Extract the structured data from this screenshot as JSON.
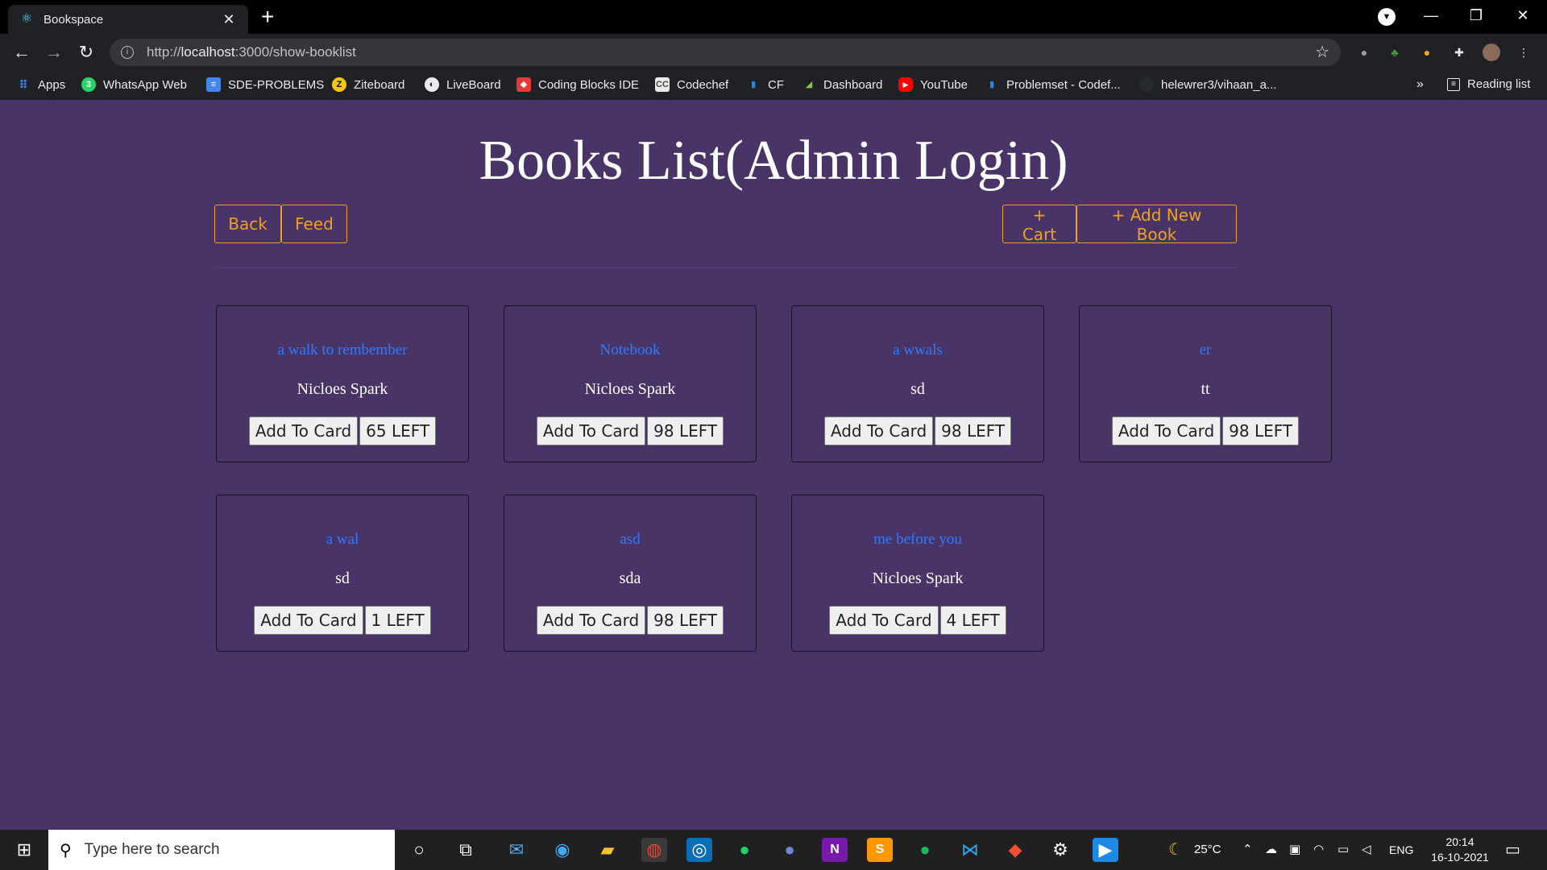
{
  "browser": {
    "tab_title": "Bookspace",
    "url_prefix": "http://",
    "url_host": "localhost",
    "url_path": ":3000/show-booklist",
    "bookmarks": [
      "Apps",
      "WhatsApp Web",
      "SDE-PROBLEMS",
      "Ziteboard",
      "LiveBoard",
      "Coding Blocks IDE",
      "Codechef",
      "CF",
      "Dashboard",
      "YouTube",
      "Problemset - Codef...",
      "helewrer3/vihaan_a..."
    ],
    "more": "»",
    "reading_list": "Reading list"
  },
  "page": {
    "title": "Books List(Admin Login)",
    "back_label": "Back",
    "feed_label": "Feed",
    "cart_label": "+ Cart",
    "add_book_label": "+ Add New Book"
  },
  "books": [
    {
      "title": "a walk to rembember",
      "author": "Nicloes Spark",
      "add_label": "Add To Card",
      "stock_label": "65 LEFT"
    },
    {
      "title": "Notebook",
      "author": "Nicloes Spark",
      "add_label": "Add To Card",
      "stock_label": "98 LEFT"
    },
    {
      "title": "a wwals",
      "author": "sd",
      "add_label": "Add To Card",
      "stock_label": "98 LEFT"
    },
    {
      "title": "er",
      "author": "tt",
      "add_label": "Add To Card",
      "stock_label": "98 LEFT"
    },
    {
      "title": "a wal",
      "author": "sd",
      "add_label": "Add To Card",
      "stock_label": "1 LEFT"
    },
    {
      "title": "asd",
      "author": "sda",
      "add_label": "Add To Card",
      "stock_label": "98 LEFT"
    },
    {
      "title": "me before you",
      "author": "Nicloes Spark",
      "add_label": "Add To Card",
      "stock_label": "4 LEFT"
    }
  ],
  "taskbar": {
    "search_placeholder": "Type here to search",
    "temperature": "25°C",
    "language": "ENG",
    "time": "20:14",
    "date": "16-10-2021"
  },
  "colors": {
    "page_background": "#483466",
    "accent_orange": "#f0a020",
    "book_title_blue": "#2f7bff"
  }
}
